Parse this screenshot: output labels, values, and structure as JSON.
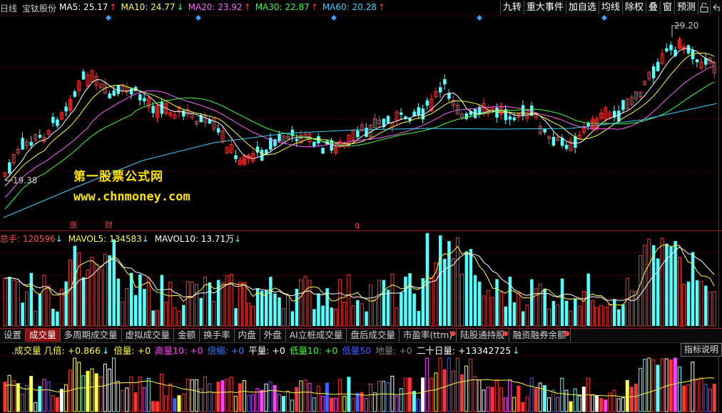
{
  "header": {
    "period": "日线",
    "stock_name": "宝钛股份",
    "ma": [
      {
        "label": "MA5: 25.17",
        "arrow": "↑",
        "color": "#ffffff"
      },
      {
        "label": "MA10: 24.77",
        "arrow": "↓",
        "color": "#ffff40"
      },
      {
        "label": "MA20: 23.92",
        "arrow": "↑",
        "color": "#ff60ff"
      },
      {
        "label": "MA30: 22.87",
        "arrow": "↑",
        "color": "#40ff40"
      },
      {
        "label": "MA60: 20.28",
        "arrow": "↑",
        "color": "#40d0ff"
      }
    ],
    "buttons": [
      "九转",
      "重大事件",
      "加自选",
      "均线",
      "除权",
      "叠",
      "窗",
      "预测"
    ],
    "icon_buttons": [
      "lock-icon",
      "back-icon"
    ]
  },
  "price_chart": {
    "high_label": "29.20",
    "low_label": "19.38",
    "markers": [
      "涨",
      "财",
      "q"
    ]
  },
  "watermark": {
    "line1": "第一股票公式网",
    "line2": "www.chnmoney.com"
  },
  "volume_panel": {
    "total_label": "总手: 120596",
    "total_arrow": "↓",
    "mavol5_label": "MAVOL5: 134583",
    "mavol5_arrow": "↓",
    "mavol10_label": "MAVOL10: 13.71万",
    "mavol10_arrow": "↓"
  },
  "tabs": [
    {
      "label": "设置",
      "active": false,
      "dot": false
    },
    {
      "label": "成交量",
      "active": true,
      "dot": false
    },
    {
      "label": "多周期成交量",
      "active": false,
      "dot": false
    },
    {
      "label": "虚拟成交量",
      "active": false,
      "dot": false
    },
    {
      "label": "金额",
      "active": false,
      "dot": false
    },
    {
      "label": "换手率",
      "active": false,
      "dot": false
    },
    {
      "label": "内盘",
      "active": false,
      "dot": false
    },
    {
      "label": "外盘",
      "active": false,
      "dot": false
    },
    {
      "label": "AI立桩成交量",
      "active": false,
      "dot": false
    },
    {
      "label": "盘后成交量",
      "active": false,
      "dot": false
    },
    {
      "label": "市盈率(ttm)",
      "active": false,
      "dot": true
    },
    {
      "label": "陆股通持股",
      "active": false,
      "dot": true
    },
    {
      "label": "融资融券余额",
      "active": false,
      "dot": true
    }
  ],
  "indicator": {
    "name": ".成交量",
    "fields": [
      {
        "label": "几倍: +0.866",
        "arrow": "↓",
        "color": "#ffff40"
      },
      {
        "label": "倍量: +0",
        "color": "#ffff40"
      },
      {
        "label": "高量10: +0",
        "color": "#ff40ff"
      },
      {
        "label": "倍缩: +0",
        "color": "#4080ff"
      },
      {
        "label": "平量: +0",
        "color": "#ffffff"
      },
      {
        "label": "低量10: +0",
        "color": "#40ff40"
      },
      {
        "label": "低量50",
        "color": "#4060ff"
      },
      {
        "label": "地量: +0",
        "color": "#808080"
      },
      {
        "label": "二十日量: +13342725",
        "arrow": "↓",
        "color": "#ffffff"
      }
    ],
    "explain_button": "指标说明"
  },
  "colors": {
    "up": "#ff3333",
    "down": "#54ffff",
    "grid": "#7a1010"
  }
}
